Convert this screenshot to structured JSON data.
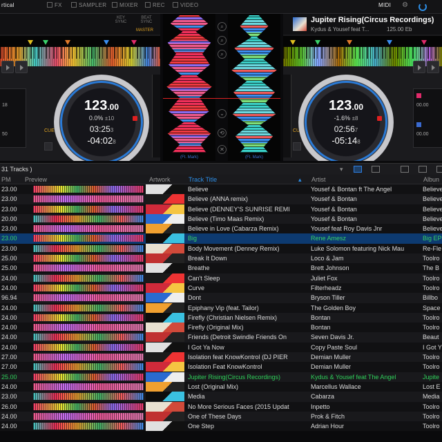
{
  "toolbar": {
    "layout_label": "rtical",
    "items": [
      "FX",
      "SAMPLER",
      "MIXER",
      "REC",
      "VIDEO"
    ],
    "midi_label": "MIDI"
  },
  "deck_left": {
    "key_sync_label": "KEY SYNC",
    "beat_sync_label": "BEAT SYNC",
    "master_label": "MASTER",
    "bpm_int": "123",
    "bpm_dec": ".00",
    "pitch": "0.0%",
    "pitch_range": "±10",
    "elapsed": "03:25",
    "elapsed_frac": "3",
    "remaining": "-04:02",
    "remaining_frac": "8",
    "side_values": [
      "18",
      "50"
    ],
    "cue_label": "CUE"
  },
  "deck_right": {
    "title": "Jupiter Rising(Circus Recordings)",
    "artist": "Kydus & Yousef feat T...",
    "bpm_info": "125.00 Eb",
    "bpm_int": "123",
    "bpm_dec": ".00",
    "pitch": "-1.6%",
    "pitch_range": "±8",
    "elapsed": "02:56",
    "elapsed_frac": "7",
    "remaining": "-05:14",
    "remaining_frac": "8",
    "side_values": [
      "00.00",
      "00.00"
    ],
    "cue_label": "CUE"
  },
  "mixer": {
    "wave_a_label": "(Ft. Mark)",
    "wave_b_label": "(Ft. Mark)",
    "buttons": [
      "⌕",
      "⌕",
      "⌕",
      "⌄",
      "⟲",
      "✕"
    ]
  },
  "browser": {
    "track_count": "31 Tracks )",
    "columns": {
      "bpm": "PM",
      "preview": "Preview",
      "artwork": "Artwork",
      "title": "Track Title",
      "artist": "Artist",
      "album": "Albun"
    },
    "tracks": [
      {
        "bpm": "23.00",
        "title": "Believe",
        "artist": "Yousef & Bontan ft The Angel",
        "album": "Believe",
        "state": "",
        "wave": "v1",
        "art": ""
      },
      {
        "bpm": "23.00",
        "title": "Believe (ANNA remix)",
        "artist": "Yousef & Bontan",
        "album": "Believe",
        "state": "",
        "wave": "v2",
        "art": ""
      },
      {
        "bpm": "23.00",
        "title": "Believe (DENNEY'S SUNRISE REMI",
        "artist": "Yousef & Bontan",
        "album": "Believe",
        "state": "",
        "wave": "v1",
        "art": ""
      },
      {
        "bpm": "20.00",
        "title": "Believe (Timo Maas Remix)",
        "artist": "Yousef & Bontan",
        "album": "Believe",
        "state": "",
        "wave": "v3",
        "art": ""
      },
      {
        "bpm": "23.00",
        "title": "Believe in Love (Cabarza Remix)",
        "artist": "Yousef feat Roy Davis Jnr",
        "album": "Believe",
        "state": "",
        "wave": "v2",
        "art": ""
      },
      {
        "bpm": "23.00",
        "title": "Big",
        "artist": "Rene Amesz",
        "album": "Big EP",
        "state": "loaded-a",
        "wave": "v1",
        "art": ""
      },
      {
        "bpm": "23.00",
        "title": "Body Movement (Denney Remix)",
        "artist": "Luke Solomon featuring Nick Mau",
        "album": "Re-Fle",
        "state": "",
        "wave": "v3",
        "art": ""
      },
      {
        "bpm": "25.00",
        "title": "Break It Down",
        "artist": "Loco & Jam",
        "album": "Toolro",
        "state": "",
        "wave": "v1",
        "art": ""
      },
      {
        "bpm": "25.00",
        "title": "Breathe",
        "artist": "Brett Johnson",
        "album": "The B",
        "state": "",
        "wave": "v2",
        "art": ""
      },
      {
        "bpm": "24.00",
        "title": "Can't Sleep",
        "artist": "Juliet Fox",
        "album": "Toolro",
        "state": "",
        "wave": "v3",
        "art": ""
      },
      {
        "bpm": "24.00",
        "title": "Curve",
        "artist": "Filterheadz",
        "album": "Toolro",
        "state": "",
        "wave": "v1",
        "art": ""
      },
      {
        "bpm": "96.94",
        "title": "Dont",
        "artist": "Bryson Tiller",
        "album": "Billbo",
        "state": "",
        "wave": "v2",
        "art": ""
      },
      {
        "bpm": "24.00",
        "title": "Epiphany Vip (feat. Tailor)",
        "artist": "The Golden Boy",
        "album": "Space",
        "state": "",
        "wave": "v3",
        "art": ""
      },
      {
        "bpm": "24.00",
        "title": "Firefly (Christian Nielsen Remix)",
        "artist": "Bontan",
        "album": "Toolro",
        "state": "",
        "wave": "v1",
        "art": ""
      },
      {
        "bpm": "24.00",
        "title": "Firefly (Original Mix)",
        "artist": "Bontan",
        "album": "Toolro",
        "state": "",
        "wave": "v2",
        "art": ""
      },
      {
        "bpm": "24.00",
        "title": "Friends (Detroit Swindle Friends On",
        "artist": "Seven Davis Jr.",
        "album": "Beaut",
        "state": "",
        "wave": "v3",
        "art": ""
      },
      {
        "bpm": "24.00",
        "title": "I Got Ya Now",
        "artist": "Copy Paste Soul",
        "album": "I Got Y",
        "state": "",
        "wave": "v1",
        "art": ""
      },
      {
        "bpm": "27.00",
        "title": "Isolation feat KnowKontrol (DJ PIER",
        "artist": "Demian Muller",
        "album": "Toolro",
        "state": "",
        "wave": "v2",
        "art": ""
      },
      {
        "bpm": "27.00",
        "title": "Isolation Feat KnowKontrol",
        "artist": "Demian Muller",
        "album": "Toolro",
        "state": "",
        "wave": "v3",
        "art": ""
      },
      {
        "bpm": "25.00",
        "title": "Jupiter Rising(Circus Recordings)",
        "artist": "Kydus & Yousef feat The Angel",
        "album": "Jupite",
        "state": "green",
        "wave": "v1",
        "art": ""
      },
      {
        "bpm": "24.00",
        "title": "Lost (Original Mix)",
        "artist": "Marcellus Wallace",
        "album": "Lost E",
        "state": "",
        "wave": "v2",
        "art": ""
      },
      {
        "bpm": "23.00",
        "title": "Media",
        "artist": "Cabarza",
        "album": "Media",
        "state": "",
        "wave": "v3",
        "art": ""
      },
      {
        "bpm": "26.00",
        "title": "No More Serious Faces (2015 Updat",
        "artist": "Inpetto",
        "album": "Toolro",
        "state": "",
        "wave": "v1",
        "art": ""
      },
      {
        "bpm": "24.00",
        "title": "One of These Days",
        "artist": "Prok & Fitch",
        "album": "Toolro",
        "state": "",
        "wave": "v2",
        "art": ""
      },
      {
        "bpm": "24.00",
        "title": "One Step",
        "artist": "Adrian Hour",
        "album": "Toolro",
        "state": "",
        "wave": "v3",
        "art": ""
      }
    ]
  },
  "colors": {
    "accent": "#2d8ee6",
    "loaded_row": "#0d3a70",
    "playing_text": "#2fd05a",
    "cue": "#e3a523",
    "ring": "#2a7ad6"
  }
}
